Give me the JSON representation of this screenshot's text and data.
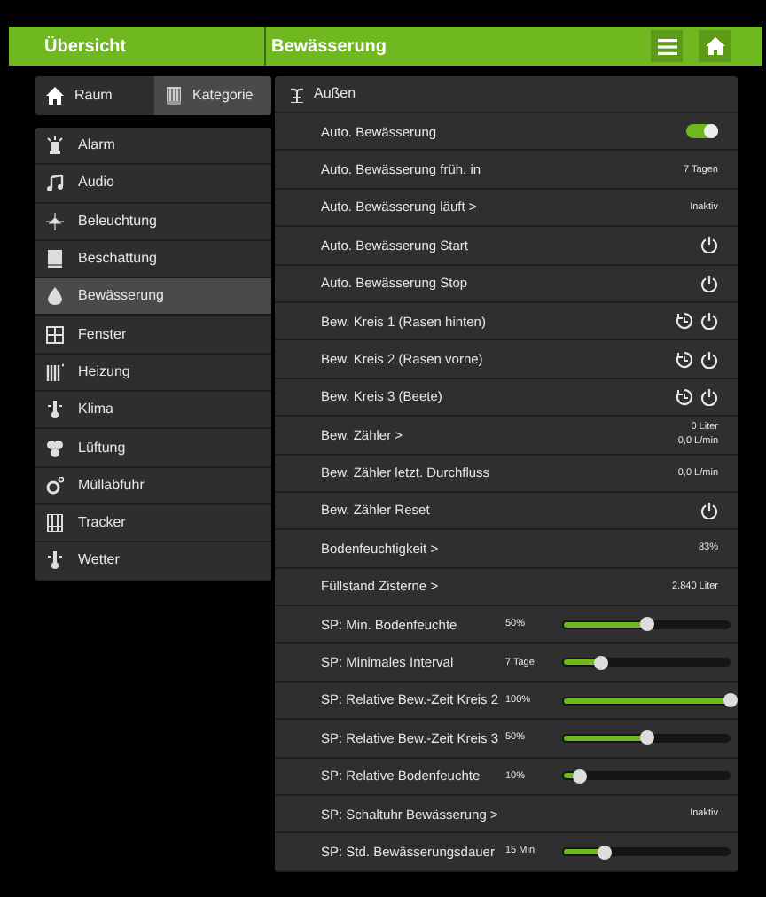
{
  "header": {
    "left_title": "Übersicht",
    "title": "Bewässerung"
  },
  "tabs": [
    {
      "label": "Raum",
      "selected": false
    },
    {
      "label": "Kategorie",
      "selected": true
    }
  ],
  "categories": [
    {
      "label": "Alarm",
      "selected": false
    },
    {
      "label": "Audio",
      "selected": false
    },
    {
      "label": "Beleuchtung",
      "selected": false
    },
    {
      "label": "Beschattung",
      "selected": false
    },
    {
      "label": "Bewässerung",
      "selected": true
    },
    {
      "label": "Fenster",
      "selected": false
    },
    {
      "label": "Heizung",
      "selected": false
    },
    {
      "label": "Klima",
      "selected": false
    },
    {
      "label": "Lüftung",
      "selected": false
    },
    {
      "label": "Müllabfuhr",
      "selected": false
    },
    {
      "label": "Tracker",
      "selected": false
    },
    {
      "label": "Wetter",
      "selected": false
    }
  ],
  "panel": {
    "title": "Außen",
    "rows": [
      {
        "kind": "toggle",
        "label": "Auto. Bewässerung",
        "on": true
      },
      {
        "kind": "value",
        "label": "Auto. Bewässerung früh. in",
        "value": "7 Tagen"
      },
      {
        "kind": "value",
        "label": "Auto. Bewässerung läuft >",
        "value": "Inaktiv"
      },
      {
        "kind": "power",
        "label": "Auto. Bewässerung Start"
      },
      {
        "kind": "power",
        "label": "Auto. Bewässerung Stop"
      },
      {
        "kind": "timer",
        "label": "Bew. Kreis 1 (Rasen hinten)"
      },
      {
        "kind": "timer",
        "label": "Bew. Kreis 2 (Rasen vorne)"
      },
      {
        "kind": "timer",
        "label": "Bew. Kreis 3 (Beete)"
      },
      {
        "kind": "value",
        "label": "Bew. Zähler >",
        "value": "0 Liter",
        "value_2": "0,0 L/min"
      },
      {
        "kind": "value",
        "label": "Bew. Zähler letzt. Durchfluss",
        "value": "0,0 L/min"
      },
      {
        "kind": "power",
        "label": "Bew. Zähler Reset"
      },
      {
        "kind": "value",
        "label": "Bodenfeuchtigkeit >",
        "value": "83%"
      },
      {
        "kind": "value",
        "label": "Füllstand Zisterne >",
        "value": "2.840 Liter"
      },
      {
        "kind": "slider",
        "label": "SP: Min. Bodenfeuchte",
        "value": "50%",
        "level": 0.5
      },
      {
        "kind": "slider",
        "label": "SP: Minimales Interval",
        "value": "7 Tage",
        "level": 0.23
      },
      {
        "kind": "slider",
        "label": "SP: Relative Bew.-Zeit Kreis 2",
        "value": "100%",
        "level": 1.0
      },
      {
        "kind": "slider",
        "label": "SP: Relative Bew.-Zeit Kreis 3",
        "value": "50%",
        "level": 0.5
      },
      {
        "kind": "slider",
        "label": "SP: Relative Bodenfeuchte",
        "value": "10%",
        "level": 0.1
      },
      {
        "kind": "value",
        "label": "SP: Schaltuhr Bewässerung >",
        "value": "Inaktiv"
      },
      {
        "kind": "slider",
        "label": "SP: Std. Bewässerungsdauer",
        "value": "15 Min",
        "level": 0.25
      }
    ]
  }
}
